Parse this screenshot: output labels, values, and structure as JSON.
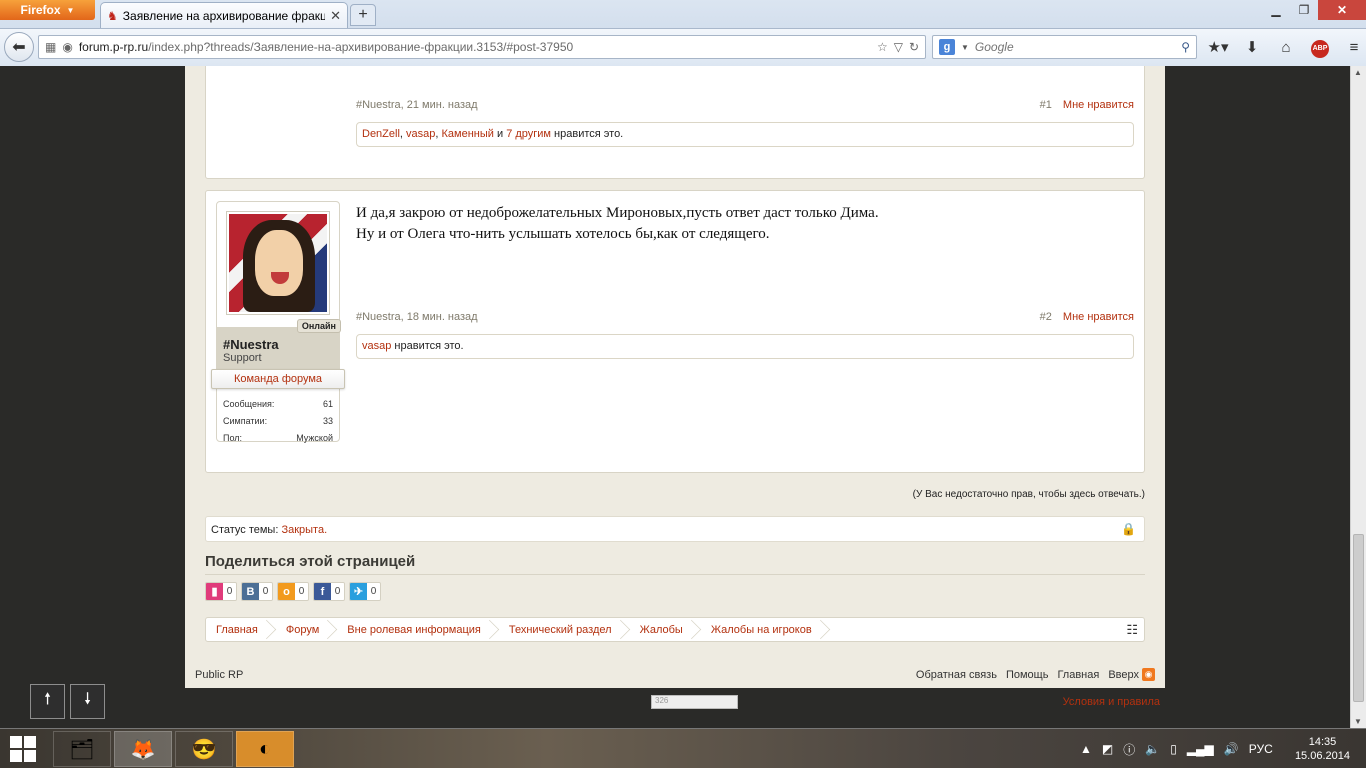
{
  "browser": {
    "menu_label": "Firefox",
    "tab_title": "Заявление на архивирование фракции...",
    "url_domain": "forum.p-rp.ru",
    "url_path": "/index.php?threads/Заявление-на-архивирование-фракции.3153/#post-37950",
    "url_prefix": "",
    "search_engine": "Google",
    "search_placeholder": "Google",
    "abp_label": "ABP"
  },
  "post1": {
    "author_meta": "#Nuestra, 21 мин. назад",
    "number": "#1",
    "like_label": "Мне нравится",
    "likes": {
      "user1": "DenZell",
      "sep1": ", ",
      "user2": "vasap",
      "sep2": ", ",
      "user3": "Каменный",
      "and": " и ",
      "others": "7 другим",
      "suffix": " нравится это."
    }
  },
  "post2": {
    "text_line1": "И да,я закрою от недоброжелательных Мироновых,пусть ответ даст только Дима.",
    "text_line2": "Ну и от Олега что-нить услышать хотелось бы,как от следящего.",
    "author_meta": "#Nuestra, 18 мин. назад",
    "number": "#2",
    "like_label": "Мне нравится",
    "likes": {
      "user1": "vasap",
      "suffix": " нравится это."
    },
    "user": {
      "online": "Онлайн",
      "name": "#Nuestra",
      "title": "Support",
      "team": "Команда форума",
      "stats": [
        {
          "label": "Сообщения:",
          "value": "61"
        },
        {
          "label": "Симпатии:",
          "value": "33"
        },
        {
          "label": "Пол:",
          "value": "Мужской"
        }
      ]
    }
  },
  "no_reply": "(У Вас недостаточно прав, чтобы здесь отвечать.)",
  "status": {
    "label": "Статус темы: ",
    "value": "Закрыта."
  },
  "share": {
    "heading": "Поделиться этой страницей",
    "buttons": [
      {
        "name": "bookmark",
        "icon": "▮",
        "count": "0",
        "color": "#e03b7b"
      },
      {
        "name": "vk",
        "icon": "B",
        "count": "0",
        "color": "#4c6f96"
      },
      {
        "name": "ok",
        "icon": "о",
        "count": "0",
        "color": "#f29a1e"
      },
      {
        "name": "facebook",
        "icon": "f",
        "count": "0",
        "color": "#3b5998"
      },
      {
        "name": "twitter",
        "icon": "✈",
        "count": "0",
        "color": "#2a9fde"
      }
    ]
  },
  "breadcrumbs": [
    "Главная",
    "Форум",
    "Вне ролевая информация",
    "Технический раздел",
    "Жалобы",
    "Жалобы на игроков"
  ],
  "footer": {
    "left": "Public RP",
    "links": [
      "Обратная связь",
      "Помощь",
      "Главная",
      "Вверх"
    ],
    "terms": "Условия и правила",
    "counter": "326"
  },
  "taskbar": {
    "lang": "РУС",
    "time": "14:35",
    "date": "15.06.2014"
  }
}
